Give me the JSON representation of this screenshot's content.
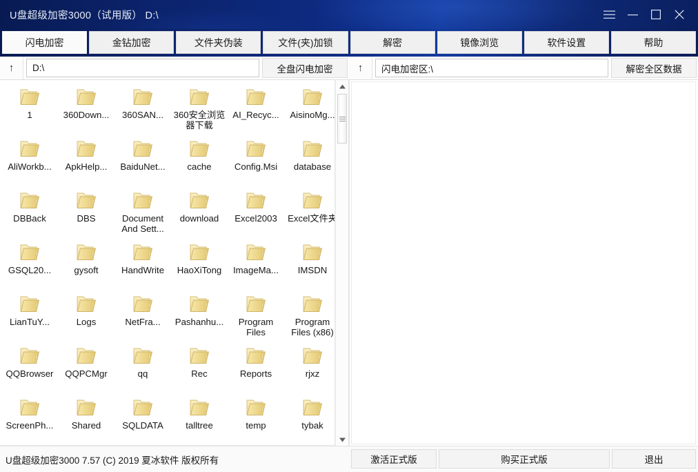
{
  "window": {
    "title": "U盘超级加密3000（试用版） D:\\",
    "controls": [
      {
        "name": "menu-icon",
        "label": "☰"
      },
      {
        "name": "minimize-button",
        "label": "─"
      },
      {
        "name": "maximize-button",
        "label": "□"
      },
      {
        "name": "close-button",
        "label": "✕"
      }
    ]
  },
  "tabs": [
    {
      "label": "闪电加密",
      "selected": true
    },
    {
      "label": "金钻加密",
      "selected": false
    },
    {
      "label": "文件夹伪装",
      "selected": false
    },
    {
      "label": "文件(夹)加锁",
      "selected": false
    },
    {
      "label": "解密",
      "selected": false
    },
    {
      "label": "镜像浏览",
      "selected": false
    },
    {
      "label": "软件设置",
      "selected": false
    },
    {
      "label": "帮助",
      "selected": false
    }
  ],
  "left_pane": {
    "up_icon": "↑",
    "path_value": "D:\\",
    "action_label": "全盘闪电加密",
    "folders": [
      "1",
      "360Down...",
      "360SAN...",
      "360安全浏览器下载",
      "AI_Recyc...",
      "AisinoMg...",
      "AliWorkb...",
      "ApkHelp...",
      "BaiduNet...",
      "cache",
      "Config.Msi",
      "database",
      "DBBack",
      "DBS",
      "Document And Sett...",
      "download",
      "Excel2003",
      "Excel文件夹",
      "GSQL20...",
      "gysoft",
      "HandWrite",
      "HaoXiTong",
      "ImageMa...",
      "IMSDN",
      "LianTuY...",
      "Logs",
      "NetFra...",
      "Pashanhu...",
      "Program Files",
      "Program Files (x86)",
      "QQBrowser",
      "QQPCMgr",
      "qq",
      "Rec",
      "Reports",
      "rjxz",
      "ScreenPh...",
      "Shared",
      "SQLDATA",
      "talltree",
      "temp",
      "tybak"
    ]
  },
  "right_pane": {
    "up_icon": "↑",
    "path_value": "闪电加密区:\\",
    "action_label": "解密全区数据",
    "content": ""
  },
  "scrollbar": {
    "up_arrow": "▲",
    "down_arrow": "▼"
  },
  "statusbar": {
    "text": "U盘超级加密3000 7.57 (C) 2019 夏冰软件 版权所有",
    "activate_label": "激活正式版",
    "purchase_label": "购买正式版",
    "exit_label": "退出"
  },
  "colors": {
    "titlebar_navy": "#0d2a80",
    "titlebar_dark": "#071a52",
    "tab_face": "#f0f0f0",
    "folder_yellow": "#f5dd92",
    "folder_yellow_dark": "#e0c26a",
    "text": "#171717"
  }
}
